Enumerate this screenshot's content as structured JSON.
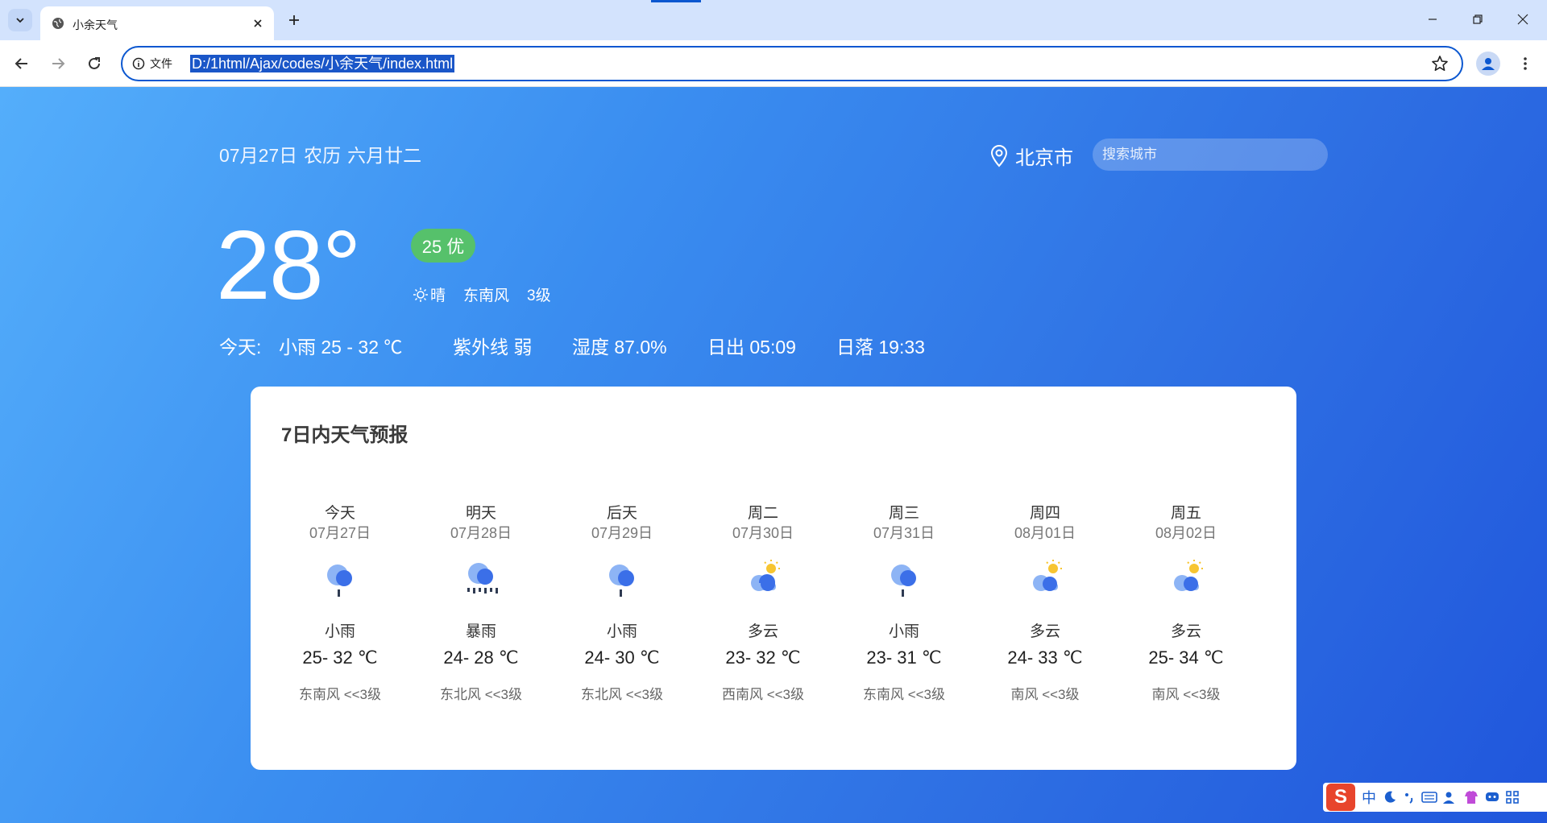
{
  "browser": {
    "tab_title": "小余天气",
    "url": "D:/1html/Ajax/codes/小余天气/index.html",
    "url_scheme_label": "文件"
  },
  "header": {
    "date": "07月27日",
    "lunar_label": "农历",
    "lunar_date": "六月廿二",
    "city": "北京市",
    "search_placeholder": "搜索城市"
  },
  "current": {
    "temperature": "28°",
    "aqi": "25 优",
    "condition": "晴",
    "wind_direction": "东南风",
    "wind_level": "3级"
  },
  "today": {
    "label": "今天:",
    "summary": "小雨 25 - 32 ℃",
    "uv": "紫外线 弱",
    "humidity": "湿度 87.0%",
    "sunrise": "日出 05:09",
    "sunset": "日落 19:33"
  },
  "forecast": {
    "title": "7日内天气预报",
    "days": [
      {
        "name": "今天",
        "date": "07月27日",
        "icon": "light-rain-icon",
        "condition": "小雨",
        "temp": "25- 32 ℃",
        "wind": "东南风 <<3级"
      },
      {
        "name": "明天",
        "date": "07月28日",
        "icon": "heavy-rain-icon",
        "condition": "暴雨",
        "temp": "24- 28 ℃",
        "wind": "东北风 <<3级"
      },
      {
        "name": "后天",
        "date": "07月29日",
        "icon": "light-rain-icon",
        "condition": "小雨",
        "temp": "24- 30 ℃",
        "wind": "东北风 <<3级"
      },
      {
        "name": "周二",
        "date": "07月30日",
        "icon": "partly-cloudy-icon",
        "condition": "多云",
        "temp": "23- 32 ℃",
        "wind": "西南风 <<3级"
      },
      {
        "name": "周三",
        "date": "07月31日",
        "icon": "light-rain-icon",
        "condition": "小雨",
        "temp": "23- 31 ℃",
        "wind": "东南风 <<3级"
      },
      {
        "name": "周四",
        "date": "08月01日",
        "icon": "partly-cloudy-icon",
        "condition": "多云",
        "temp": "24- 33 ℃",
        "wind": "南风 <<3级"
      },
      {
        "name": "周五",
        "date": "08月02日",
        "icon": "partly-cloudy-icon",
        "condition": "多云",
        "temp": "25- 34 ℃",
        "wind": "南风 <<3级"
      }
    ]
  },
  "ime": {
    "logo": "S",
    "mode": "中"
  },
  "colors": {
    "aqi_good": "#56c16b",
    "accent": "#0b57d0",
    "cloud_dark": "#3b6fe8",
    "cloud_light": "#8db4f5",
    "sun": "#f7c531"
  }
}
